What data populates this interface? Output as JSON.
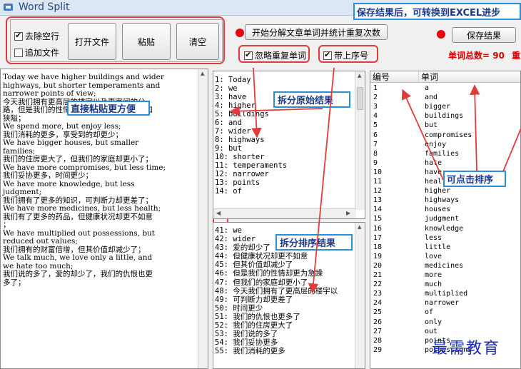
{
  "window": {
    "title": "Word Split"
  },
  "options": {
    "remove_blank": "去除空行",
    "append_file": "追加文件"
  },
  "buttons": {
    "open_file": "打开文件",
    "paste": "粘贴",
    "clear": "清空",
    "start": "开始分解文章单词并统计重复次数",
    "save": "保存结果"
  },
  "checks": {
    "ignore_dup": "忽略重复单词",
    "line_no": "带上序号"
  },
  "status": {
    "total_label": "单词总数= 90",
    "total_suffix": "重"
  },
  "callouts": {
    "save_tip": "保存结果后，可转换到EXCEL进步",
    "paste_tip": "直接粘贴更方便",
    "split_raw": "拆分原始结果",
    "split_sorted": "拆分排序结果",
    "sortable": "可点击排序"
  },
  "source_lines": [
    "Today we have higher buildings and wider",
    "highways, but shorter temperaments and",
    "narrower points of view;",
    "今天我们拥有更高层的楼宇以及更宽阔的公",
    "路，但是我们的性情却更为急躁，眼光也更加",
    "狭隘；",
    "We spend more, but enjoy less;",
    "我们消耗的更多，享受到的却更少；",
    "We have bigger houses, but smaller",
    "families;",
    "我们的住房更大了，但我们的家庭却更小了；",
    "We have more compromises, but less time;",
    "我们妥协更多，时间更少；",
    "We have more knowledge, but less",
    "judgment;",
    "我们拥有了更多的知识，可判断力却更差了；",
    "We have more medicines, but less health;",
    "我们有了更多的药品，但健康状况却更不如意",
    "；",
    "We have multiplied out possessions, but",
    "reduced out values;",
    "我们拥有的财富倍增，但其价值却减少了；",
    "We talk much, we love only a little, and",
    "we hate too much;",
    "我们说的多了，爱的却少了，我们的仇恨也更",
    "多了；"
  ],
  "raw_list": [
    "1: Today",
    "2: we",
    "3: have",
    "4: higher",
    "5: buildings",
    "6: and",
    "7: wider",
    "8: highways",
    "9: but",
    "10: shorter",
    "11: temperaments",
    "12: narrower",
    "13: points",
    "14: of"
  ],
  "sorted_list": [
    "41: we",
    "42: wider",
    "43: 爱的却少了",
    "44: 但健康状况却更不如意",
    "45: 但其价值却减少了",
    "46: 但是我们的性情却更为急躁",
    "47: 但我们的家庭却更小了",
    "48: 今天我们拥有了更高层的楼宇以",
    "49: 可判断力却更差了",
    "50: 时间更少",
    "51: 我们的仇恨也更多了",
    "52: 我们的住房更大了",
    "53: 我们说的多了",
    "54: 我们妥协更多",
    "55: 我们消耗的更多"
  ],
  "table": {
    "col_no": "编号",
    "col_word": "单词",
    "rows": [
      [
        "1",
        "a"
      ],
      [
        "2",
        "and"
      ],
      [
        "3",
        "bigger"
      ],
      [
        "4",
        "buildings"
      ],
      [
        "5",
        "but"
      ],
      [
        "6",
        "compromises"
      ],
      [
        "7",
        "enjoy"
      ],
      [
        "8",
        "families"
      ],
      [
        "9",
        "hate"
      ],
      [
        "10",
        "have"
      ],
      [
        "11",
        "health"
      ],
      [
        "12",
        "higher"
      ],
      [
        "13",
        "highways"
      ],
      [
        "14",
        "houses"
      ],
      [
        "15",
        "judgment"
      ],
      [
        "16",
        "knowledge"
      ],
      [
        "17",
        "less"
      ],
      [
        "18",
        "little"
      ],
      [
        "19",
        "love"
      ],
      [
        "20",
        "medicines"
      ],
      [
        "21",
        "more"
      ],
      [
        "22",
        "much"
      ],
      [
        "23",
        "multiplied"
      ],
      [
        "24",
        "narrower"
      ],
      [
        "25",
        "of"
      ],
      [
        "26",
        "only"
      ],
      [
        "27",
        "out"
      ],
      [
        "28",
        "points"
      ],
      [
        "29",
        "possessions"
      ]
    ]
  },
  "watermark": "最需教育",
  "colors": {
    "accent_red": "#e23b3b",
    "callout_border": "#2b8fd8",
    "total_red": "#d40000",
    "watermark": "#1c2fb5"
  }
}
